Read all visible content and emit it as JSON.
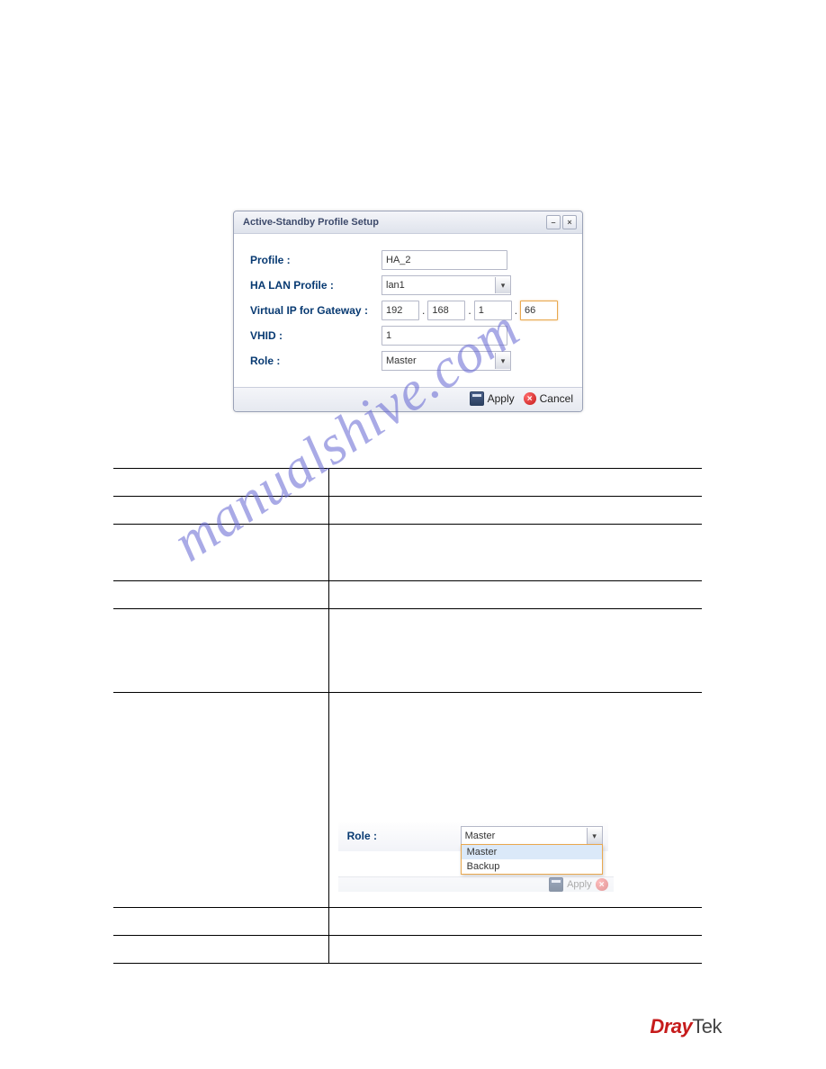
{
  "dialog": {
    "title": "Active-Standby Profile Setup",
    "labels": {
      "profile": "Profile :",
      "ha_lan": "HA LAN Profile :",
      "vip": "Virtual IP for Gateway :",
      "vhid": "VHID :",
      "role": "Role :"
    },
    "values": {
      "profile": "HA_2",
      "ha_lan": "lan1",
      "ip": [
        "192",
        "168",
        "1",
        "66"
      ],
      "vhid": "1",
      "role": "Master"
    },
    "buttons": {
      "apply": "Apply",
      "cancel": "Cancel"
    }
  },
  "role_widget": {
    "label": "Role :",
    "selected": "Master",
    "options": [
      "Master",
      "Backup"
    ],
    "ghost_apply": "Apply"
  },
  "watermark": "manualshive.com",
  "logo": {
    "part1": "Dray",
    "part2": "Tek"
  }
}
